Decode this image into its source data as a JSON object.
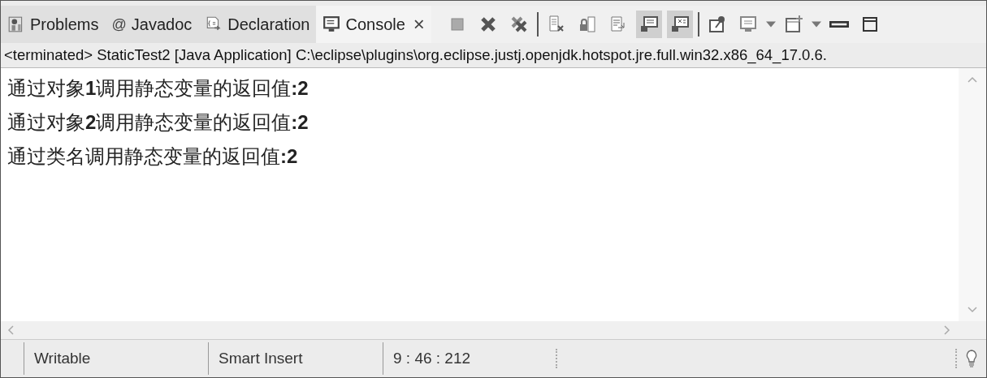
{
  "tabs": [
    {
      "kind": "problems",
      "label": "Problems",
      "selected": false
    },
    {
      "kind": "javadoc",
      "icon_text": "@",
      "label": "Javadoc",
      "selected": false
    },
    {
      "kind": "declaration",
      "label": "Declaration",
      "selected": false
    },
    {
      "kind": "console",
      "label": "Console",
      "selected": true,
      "close": "×"
    }
  ],
  "toolbar": [
    {
      "kind": "stop",
      "selected": false
    },
    {
      "kind": "remove",
      "selected": false
    },
    {
      "kind": "remove-all",
      "selected": false
    },
    {
      "kind": "sep"
    },
    {
      "kind": "clear",
      "selected": false
    },
    {
      "kind": "lock",
      "selected": false
    },
    {
      "kind": "wrap",
      "selected": false
    },
    {
      "kind": "show-out",
      "selected": true
    },
    {
      "kind": "show-err",
      "selected": true
    },
    {
      "kind": "sep"
    },
    {
      "kind": "pin",
      "selected": false
    },
    {
      "kind": "display",
      "selected": false
    },
    {
      "kind": "caret"
    },
    {
      "kind": "new",
      "selected": false
    },
    {
      "kind": "caret"
    },
    {
      "kind": "minimize"
    },
    {
      "kind": "maximize"
    }
  ],
  "console": {
    "header": "<terminated> StaticTest2 [Java Application] C:\\eclipse\\plugins\\org.eclipse.justj.openjdk.hotspot.jre.full.win32.x86_64_17.0.6.",
    "lines": [
      "通过对象**1**调用静态变量的返回值**:2**",
      "通过对象**2**调用静态变量的返回值**:2**",
      "通过类名调用静态变量的返回值**:2**"
    ]
  },
  "status_bar": {
    "fields": [
      "Writable",
      "Smart Insert",
      "9 : 46 : 212"
    ]
  }
}
